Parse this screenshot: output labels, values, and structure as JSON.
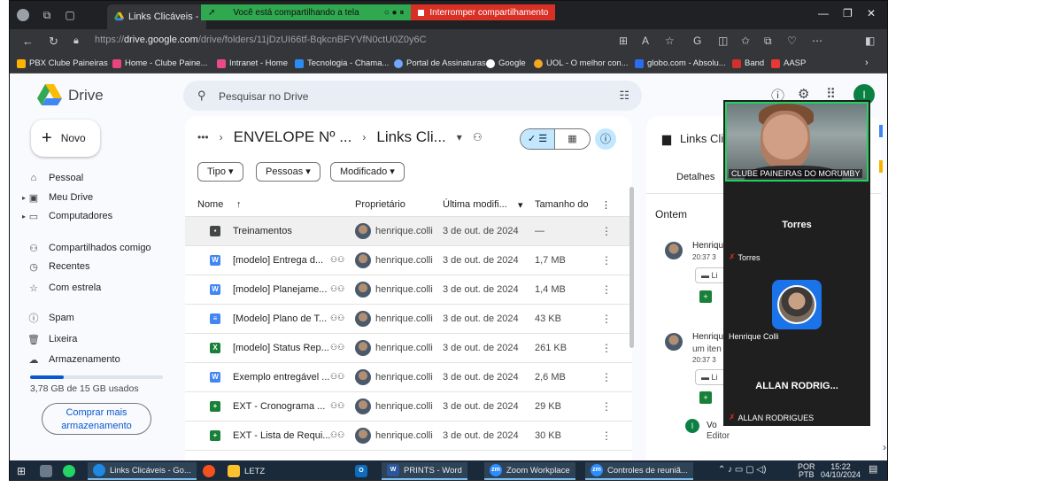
{
  "browser": {
    "tab_title": "Links Clicáveis - Goog",
    "share_notice": "Você está compartilhando a tela",
    "share_stop": "Interromper compartilhamento",
    "url_prefix": "https://",
    "url_domain": "drive.google.com",
    "url_path": "/drive/folders/11jDzUI66tf-BqkcnBFYVfN0ctU0Z0y6C",
    "bookmarks": [
      {
        "label": "PBX Clube Paineiras",
        "color": "#ffb300"
      },
      {
        "label": "Home - Clube Paine...",
        "color": "#e8457a"
      },
      {
        "label": "Intranet - Home",
        "color": "#e94a8a"
      },
      {
        "label": "Tecnologia - Chama...",
        "color": "#2a8cf0"
      },
      {
        "label": "Portal de Assinaturas",
        "color": "#6ea8ff"
      },
      {
        "label": "Google",
        "color": "#ffffff"
      },
      {
        "label": "UOL - O melhor con...",
        "color": "#f5a623"
      },
      {
        "label": "globo.com - Absolu...",
        "color": "#2b6cf0"
      },
      {
        "label": "Band",
        "color": "#d32f2f"
      },
      {
        "label": "AASP",
        "color": "#e53935"
      }
    ]
  },
  "drive": {
    "logo_text": "Drive",
    "search_placeholder": "Pesquisar no Drive",
    "new_label": "Novo",
    "sidebar": [
      {
        "label": "Pessoal",
        "icon": "home-icon"
      },
      {
        "label": "Meu Drive",
        "icon": "drive-icon"
      },
      {
        "label": "Computadores",
        "icon": "computer-icon"
      },
      {
        "label": "Compartilhados comigo",
        "icon": "people-icon"
      },
      {
        "label": "Recentes",
        "icon": "clock-icon"
      },
      {
        "label": "Com estrela",
        "icon": "star-icon"
      },
      {
        "label": "Spam",
        "icon": "spam-icon"
      },
      {
        "label": "Lixeira",
        "icon": "trash-icon"
      },
      {
        "label": "Armazenamento",
        "icon": "cloud-icon"
      }
    ],
    "storage_used_fraction": 0.252,
    "storage_text": "3,78 GB de 15 GB usados",
    "buy_storage_label": "Comprar mais armazenamento",
    "breadcrumb": {
      "ellipsis": "•••",
      "folder1": "ENVELOPE Nº ...",
      "folder2": "Links Cli..."
    },
    "filters": [
      "Tipo",
      "Pessoas",
      "Modificado"
    ],
    "columns": {
      "name": "Nome",
      "owner": "Proprietário",
      "modified": "Última modifi...",
      "size": "Tamanho do"
    },
    "files": [
      {
        "name": "Treinamentos",
        "type": "folder",
        "shared": false,
        "owner": "henrique.colli",
        "modified": "3 de out. de 2024",
        "size": "—"
      },
      {
        "name": "[modelo] Entrega d...",
        "type": "word",
        "shared": true,
        "owner": "henrique.colli",
        "modified": "3 de out. de 2024",
        "size": "1,7 MB"
      },
      {
        "name": "[modelo] Planejame...",
        "type": "word",
        "shared": true,
        "owner": "henrique.colli",
        "modified": "3 de out. de 2024",
        "size": "1,4 MB"
      },
      {
        "name": "[Modelo] Plano de T...",
        "type": "doc",
        "shared": true,
        "owner": "henrique.colli",
        "modified": "3 de out. de 2024",
        "size": "43 KB"
      },
      {
        "name": "[modelo] Status Rep...",
        "type": "excel",
        "shared": true,
        "owner": "henrique.colli",
        "modified": "3 de out. de 2024",
        "size": "261 KB"
      },
      {
        "name": "Exemplo entregável ...",
        "type": "word",
        "shared": true,
        "owner": "henrique.colli",
        "modified": "3 de out. de 2024",
        "size": "2,6 MB"
      },
      {
        "name": "EXT - Cronograma ...",
        "type": "sheet",
        "shared": true,
        "owner": "henrique.colli",
        "modified": "3 de out. de 2024",
        "size": "29 KB"
      },
      {
        "name": "EXT - Lista de Requi...",
        "type": "sheet",
        "shared": true,
        "owner": "henrique.colli",
        "modified": "3 de out. de 2024",
        "size": "30 KB"
      }
    ],
    "details": {
      "title": "Links Cli",
      "tab": "Detalhes",
      "section": "Ontem",
      "act1_name": "Henriqu",
      "act1_time": "20:37 3",
      "act1_chip": "Li",
      "act2_name": "Henriqu",
      "act2_line": "um iten",
      "act2_time": "20:37 3",
      "act2_chip": "Li",
      "editor_initial": "I",
      "editor_name": "Vo",
      "editor_role": "Editor"
    }
  },
  "zoom": {
    "video_name": "CLUBE PAINEIRAS DO MORUMBY",
    "p1_big": "Torres",
    "p1_label": "Torres",
    "p2_label": "Henrique Colli",
    "p3_big": "ALLAN RODRIG...",
    "p3_label": "ALLAN RODRIGUES"
  },
  "taskbar": {
    "items": [
      "Links Clicáveis - Go...",
      "LETZ",
      "PRINTS - Word",
      "Zoom Workplace",
      "Controles de reuniã..."
    ],
    "lang": "POR",
    "lang2": "PTB",
    "time": "15:22",
    "date": "04/10/2024"
  },
  "colors": {
    "accent": "#0b57d0",
    "selected": "#c2e7ff",
    "share_green": "#2fa84f",
    "share_red": "#d93025"
  }
}
